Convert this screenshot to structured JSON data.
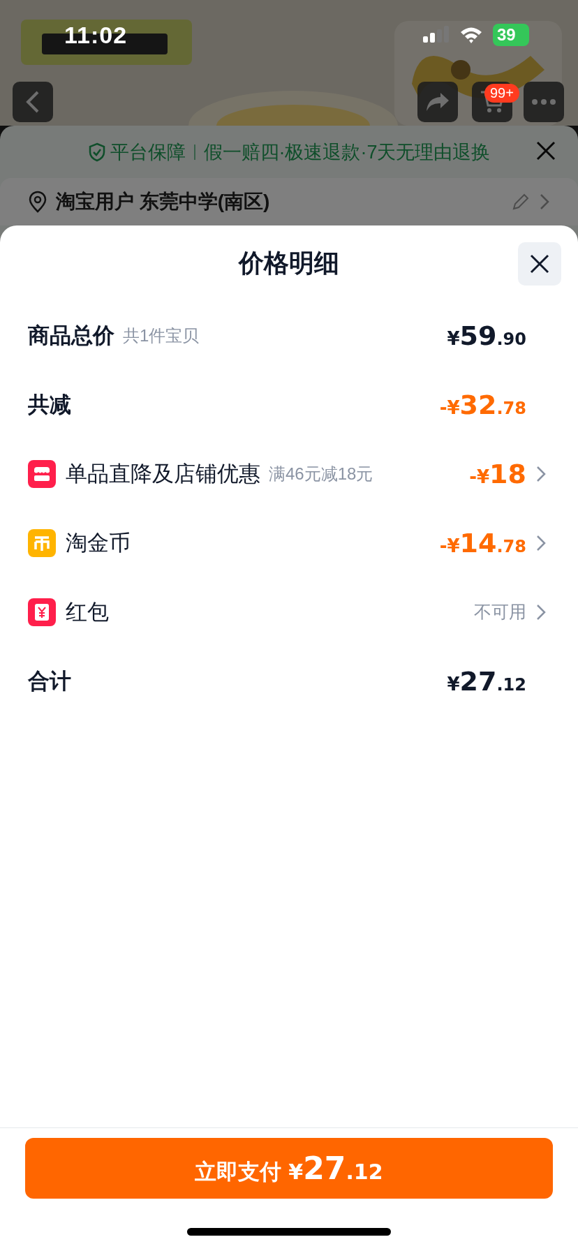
{
  "status_bar": {
    "time": "11:02",
    "battery": "39"
  },
  "background_page": {
    "cart_badge": "99+",
    "guarantee": {
      "title": "平台保障",
      "text": "假一赔四·极速退款·7天无理由退换"
    },
    "address": "淘宝用户 东莞中学(南区)"
  },
  "sheet": {
    "title": "价格明细",
    "rows": [
      {
        "kind": "summary",
        "label": "商品总价",
        "note": "共1件宝贝",
        "amount": {
          "currency": "¥",
          "whole": "59",
          "fraction": ".90"
        },
        "discount": false
      },
      {
        "kind": "summary",
        "label": "共减",
        "amount": {
          "sign": "-",
          "currency": "¥",
          "whole": "32",
          "fraction": ".78"
        },
        "discount": true
      },
      {
        "kind": "shop",
        "label": "单品直降及店铺优惠",
        "note": "满46元减18元",
        "amount": {
          "sign": "-",
          "currency": "¥",
          "whole": "18"
        },
        "discount": true
      },
      {
        "kind": "coin",
        "label": "淘金币",
        "amount": {
          "sign": "-",
          "currency": "¥",
          "whole": "14",
          "fraction": ".78"
        },
        "discount": true
      },
      {
        "kind": "packet",
        "label": "红包",
        "status": "不可用"
      },
      {
        "kind": "summary",
        "label": "合计",
        "amount": {
          "currency": "¥",
          "whole": "27",
          "fraction": ".12"
        },
        "discount": false
      }
    ]
  },
  "pay_button": {
    "label": "立即支付",
    "currency": "¥",
    "whole": "27",
    "fraction": ".12"
  }
}
